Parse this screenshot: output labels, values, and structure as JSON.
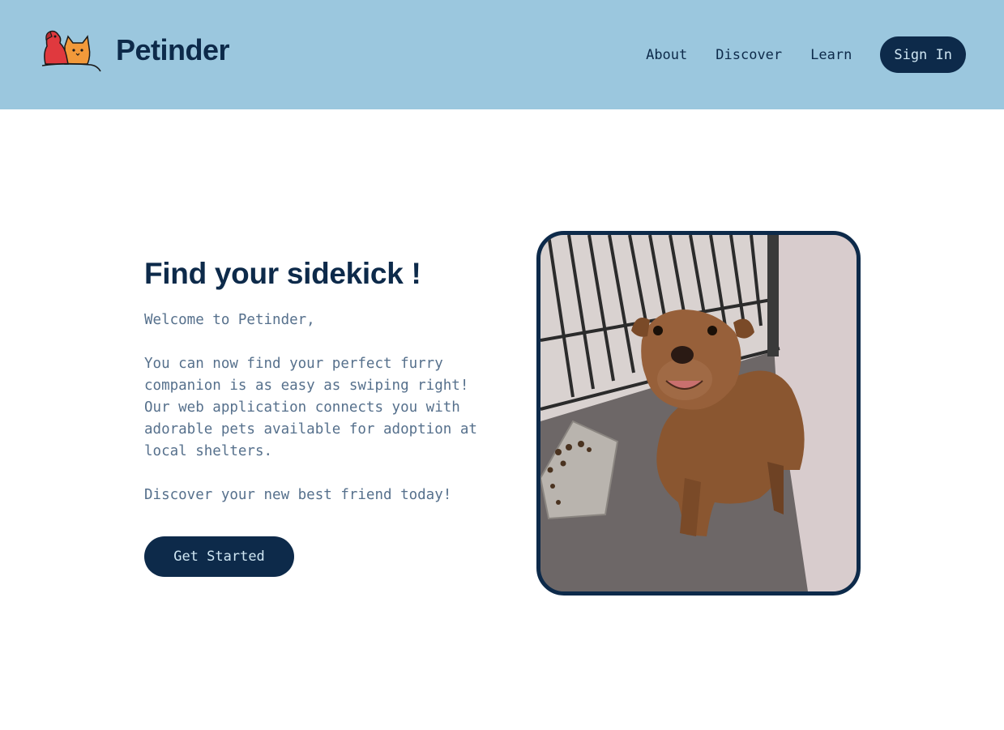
{
  "header": {
    "brand": "Petinder",
    "nav": [
      "About",
      "Discover",
      "Learn"
    ],
    "signin_label": "Sign In"
  },
  "hero": {
    "title": "Find your sidekick !",
    "body": "Welcome to Petinder,\n\nYou can now find your perfect furry\ncompanion is as easy as swiping right!\nOur web application connects you with\nadorable pets available for adoption at\nlocal shelters.\n\nDiscover your new best friend today!",
    "cta_label": "Get Started"
  },
  "colors": {
    "header_bg": "#9bc7de",
    "navy": "#0d2a4a",
    "body_text": "#56708c"
  },
  "icons": {
    "logo": "dog-and-cat-logo-icon"
  }
}
